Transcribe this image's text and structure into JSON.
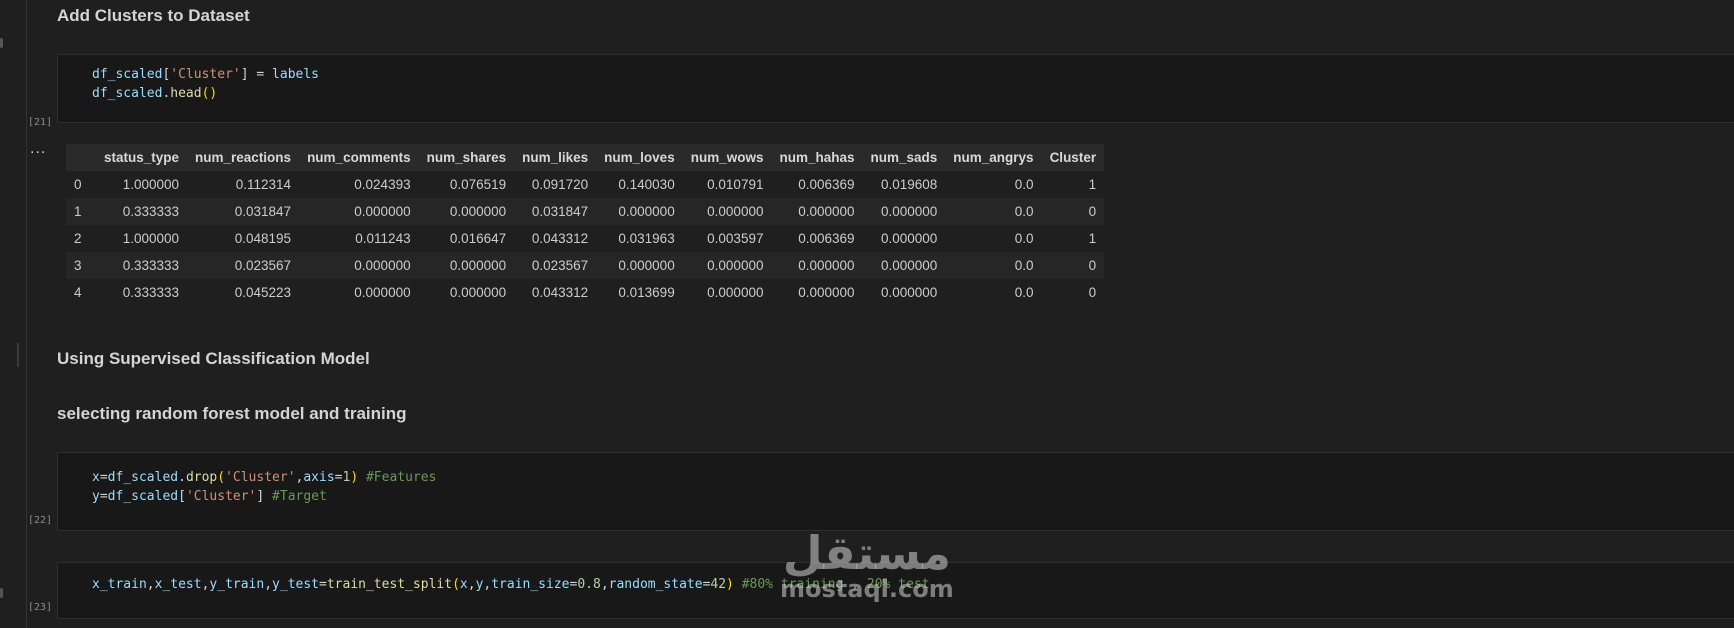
{
  "cells": {
    "md_add_clusters": "Add Clusters to Dataset",
    "code21": {
      "exec_count": "[21]",
      "line1": {
        "var": "df_scaled",
        "lb": "[",
        "str": "'Cluster'",
        "rb": "]",
        "op": " = ",
        "rhs": "labels"
      },
      "line2": {
        "var": "df_scaled",
        "dot": ".",
        "fn": "head",
        "par": "()"
      }
    },
    "output_ellipsis": "...",
    "table": {
      "columns": [
        "",
        "status_type",
        "num_reactions",
        "num_comments",
        "num_shares",
        "num_likes",
        "num_loves",
        "num_wows",
        "num_hahas",
        "num_sads",
        "num_angrys",
        "Cluster"
      ],
      "rows": [
        [
          "0",
          "1.000000",
          "0.112314",
          "0.024393",
          "0.076519",
          "0.091720",
          "0.140030",
          "0.010791",
          "0.006369",
          "0.019608",
          "0.0",
          "1"
        ],
        [
          "1",
          "0.333333",
          "0.031847",
          "0.000000",
          "0.000000",
          "0.031847",
          "0.000000",
          "0.000000",
          "0.000000",
          "0.000000",
          "0.0",
          "0"
        ],
        [
          "2",
          "1.000000",
          "0.048195",
          "0.011243",
          "0.016647",
          "0.043312",
          "0.031963",
          "0.003597",
          "0.006369",
          "0.000000",
          "0.0",
          "1"
        ],
        [
          "3",
          "0.333333",
          "0.023567",
          "0.000000",
          "0.000000",
          "0.023567",
          "0.000000",
          "0.000000",
          "0.000000",
          "0.000000",
          "0.0",
          "0"
        ],
        [
          "4",
          "0.333333",
          "0.045223",
          "0.000000",
          "0.000000",
          "0.043312",
          "0.013699",
          "0.000000",
          "0.000000",
          "0.000000",
          "0.0",
          "0"
        ]
      ]
    },
    "md_supervised": "Using Supervised Classification Model",
    "md_random_forest": "selecting random forest model and training",
    "code22": {
      "exec_count": "[22]",
      "line1": {
        "a": "x",
        "b": "=",
        "c": "df_scaled",
        "d": ".",
        "e": "drop",
        "f": "(",
        "g": "'Cluster'",
        "h": ",",
        "i": "axis",
        "j": "=",
        "k": "1",
        "l": ")",
        "m": " ",
        "n": "#Features"
      },
      "line2": {
        "a": "y",
        "b": "=",
        "c": "df_scaled",
        "d": "[",
        "e": "'Cluster'",
        "f": "]",
        "g": " ",
        "h": "#Target"
      }
    },
    "code23": {
      "exec_count": "[23]",
      "tokens": {
        "t1": "x_train",
        "t2": ",",
        "t3": "x_test",
        "t4": ",",
        "t5": "y_train",
        "t6": ",",
        "t7": "y_test",
        "t8": "=",
        "t9": "train_test_split",
        "t10": "(",
        "t11": "x",
        "t12": ",",
        "t13": "y",
        "t14": ",",
        "t15": "train_size",
        "t16": "=",
        "t17": "0.8",
        "t18": ",",
        "t19": "random_state",
        "t20": "=",
        "t21": "42",
        "t22": ")",
        "t23": " ",
        "t24": "#80% training , 20% test"
      }
    }
  },
  "watermark": {
    "arabic": "مستقل",
    "latin": "mostaql.com"
  },
  "colors": {
    "background": "#1f1f1f",
    "cell_bg": "#181818",
    "string": "#ce9178",
    "variable": "#9cdcfe",
    "function": "#dcdcaa",
    "number": "#b5cea8",
    "comment": "#6a9955"
  }
}
